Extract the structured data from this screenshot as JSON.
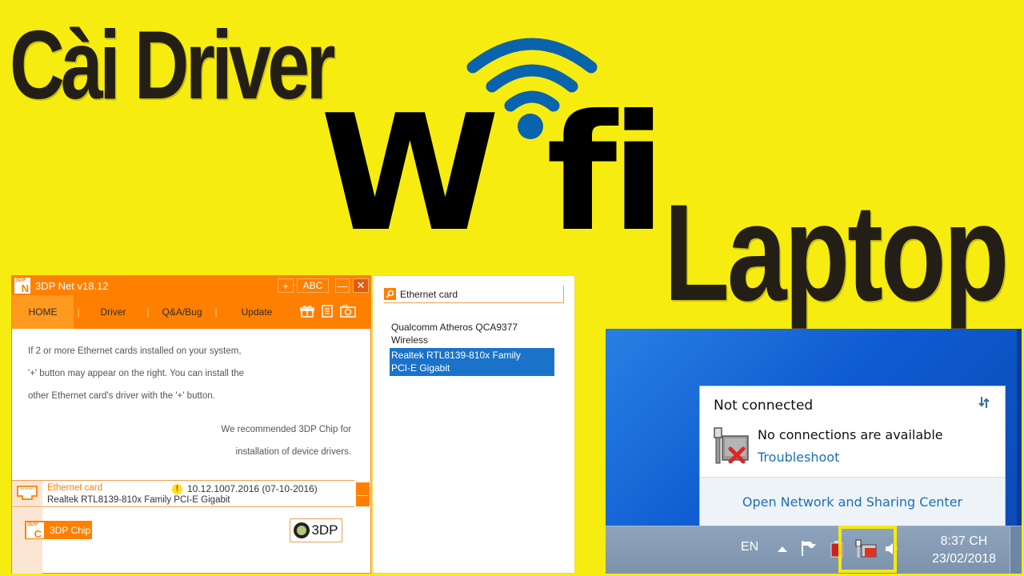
{
  "thumbnail": {
    "title_line1": "Cài Driver",
    "title_line2": "Wifi",
    "title_line3": "Laptop",
    "colors": {
      "background": "#f7ec0f",
      "text": "#231f16",
      "wifi_arcs": "#0a64ad",
      "accent_orange": "#ff7f00",
      "win_blue": "#0e5bd1"
    }
  },
  "app": {
    "logo_small": "3DP",
    "logo_big": "N",
    "title": "3DP Net v18.12",
    "titlebar_buttons": {
      "plus": "+",
      "abc": "ABC",
      "minimize": "—",
      "close": "✕"
    },
    "nav": [
      {
        "label": "HOME",
        "active": true
      },
      {
        "label": "Driver"
      },
      {
        "label": "Q&A/Bug"
      },
      {
        "label": "Update"
      }
    ],
    "nav_separator": "|",
    "nav_icons": [
      "gift-icon",
      "list-icon",
      "camera-icon"
    ],
    "body_text": [
      "If 2 or more Ethernet cards installed on your system,",
      "'+' button may appear on the right. You can install the",
      "other Ethernet card's driver with the '+' button."
    ],
    "recommend_text": [
      "We recommended 3DP Chip for",
      "installation of device drivers."
    ],
    "ethernet": {
      "category": "Ethernet card",
      "warning_glyph": "!",
      "version": "10.12.1007.2016 (07-10-2016)",
      "model": "Realtek RTL8139-810x Family PCI-E Gigabit",
      "collapse": "—"
    },
    "chip_button": {
      "logo_small": "3DP",
      "logo_big": "C",
      "label": "3DP Chip"
    },
    "brand_button": {
      "label": "3DP"
    }
  },
  "device_panel": {
    "search_value": "Ethernet card",
    "devices": [
      {
        "name": "Qualcomm Atheros QCA9377 Wireless",
        "lines": [
          "Qualcomm Atheros QCA9377",
          "Wireless"
        ],
        "selected": false
      },
      {
        "name": "Realtek RTL8139-810x Family PCI-E Gigabit",
        "lines": [
          "Realtek RTL8139-810x Family",
          "PCI-E Gigabit"
        ],
        "selected": true
      }
    ]
  },
  "windows": {
    "popup": {
      "status": "Not connected",
      "message": "No connections are available",
      "troubleshoot": "Troubleshoot",
      "open_center": "Open Network and Sharing Center"
    },
    "taskbar": {
      "language": "EN",
      "time": "8:37 CH",
      "date": "23/02/2018"
    }
  }
}
